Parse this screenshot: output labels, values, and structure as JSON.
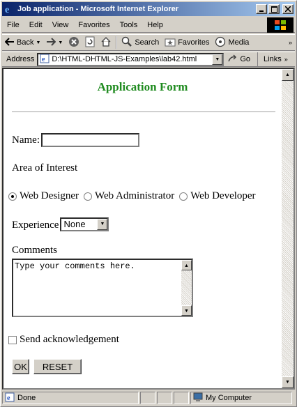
{
  "window": {
    "title": "Job application - Microsoft Internet Explorer"
  },
  "menu": [
    {
      "label": "File",
      "key": "F",
      "rest": "ile"
    },
    {
      "label": "Edit",
      "key": "E",
      "rest": "dit"
    },
    {
      "label": "View",
      "key": "V",
      "rest": "iew"
    },
    {
      "label": "Favorites",
      "key": "a",
      "pre": "F",
      "rest": "vorites"
    },
    {
      "label": "Tools",
      "key": "T",
      "rest": "ools"
    },
    {
      "label": "Help",
      "key": "H",
      "rest": "elp"
    }
  ],
  "toolbar": {
    "back": "Back",
    "search": "Search",
    "favorites": "Favorites",
    "media": "Media"
  },
  "address": {
    "label": "Address",
    "value": "D:\\HTML-DHTML-JS-Examples\\lab42.html",
    "go": "Go",
    "links": "Links"
  },
  "form": {
    "heading": "Application Form",
    "name_label": "Name:",
    "name_value": "",
    "area_label": "Area of Interest",
    "radios": [
      "Web Designer",
      "Web Administrator",
      "Web Developer"
    ],
    "radio_selected": "Web Designer",
    "experience_label": "Experience",
    "experience_value": "None",
    "comments_label": "Comments",
    "comments_value": "Type your comments here.",
    "ack_label": "Send acknowledgement",
    "ack_checked": false,
    "ok": "OK",
    "reset": "RESET"
  },
  "status": {
    "text": "Done",
    "zone": "My Computer"
  },
  "colors": {
    "heading": "#1f8b1f",
    "titlebar": "#0a246a"
  }
}
